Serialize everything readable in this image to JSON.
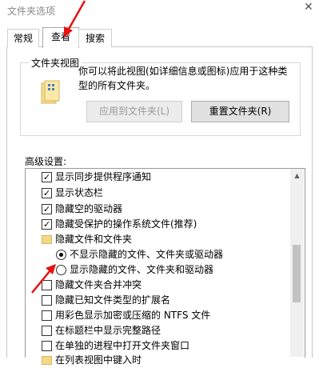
{
  "dialog": {
    "title": "文件夹选项",
    "close_glyph": "✕"
  },
  "tabs": [
    {
      "label": "常规",
      "active": false
    },
    {
      "label": "查看",
      "active": true
    },
    {
      "label": "搜索",
      "active": false
    }
  ],
  "folder_views": {
    "group_label": "文件夹视图",
    "description": "你可以将此视图(如详细信息或图标)应用于这种类型的所有文件夹。",
    "apply_button": "应用到文件夹(L)",
    "reset_button": "重置文件夹(R)"
  },
  "advanced": {
    "label": "高级设置:",
    "items": [
      {
        "type": "checkbox",
        "label": "显示同步提供程序通知",
        "checked": true
      },
      {
        "type": "checkbox",
        "label": "显示状态栏",
        "checked": true
      },
      {
        "type": "checkbox",
        "label": "隐藏空的驱动器",
        "checked": true
      },
      {
        "type": "checkbox",
        "label": "隐藏受保护的操作系统文件(推荐)",
        "checked": true
      },
      {
        "type": "folder",
        "label": "隐藏文件和文件夹"
      },
      {
        "type": "radio",
        "label": "不显示隐藏的文件、文件夹或驱动器",
        "checked": true
      },
      {
        "type": "radio",
        "label": "显示隐藏的文件、文件夹和驱动器",
        "checked": false
      },
      {
        "type": "checkbox",
        "label": "隐藏文件夹合并冲突",
        "checked": false
      },
      {
        "type": "checkbox",
        "label": "隐藏已知文件类型的扩展名",
        "checked": false
      },
      {
        "type": "checkbox",
        "label": "用彩色显示加密或压缩的 NTFS 文件",
        "checked": false
      },
      {
        "type": "checkbox",
        "label": "在标题栏中显示完整路径",
        "checked": false
      },
      {
        "type": "checkbox",
        "label": "在单独的进程中打开文件夹窗口",
        "checked": false
      },
      {
        "type": "folder",
        "label": "在列表视图中键入时"
      }
    ]
  },
  "colors": {
    "annotation_arrow": "#e81010",
    "accent": "#0078d7"
  }
}
